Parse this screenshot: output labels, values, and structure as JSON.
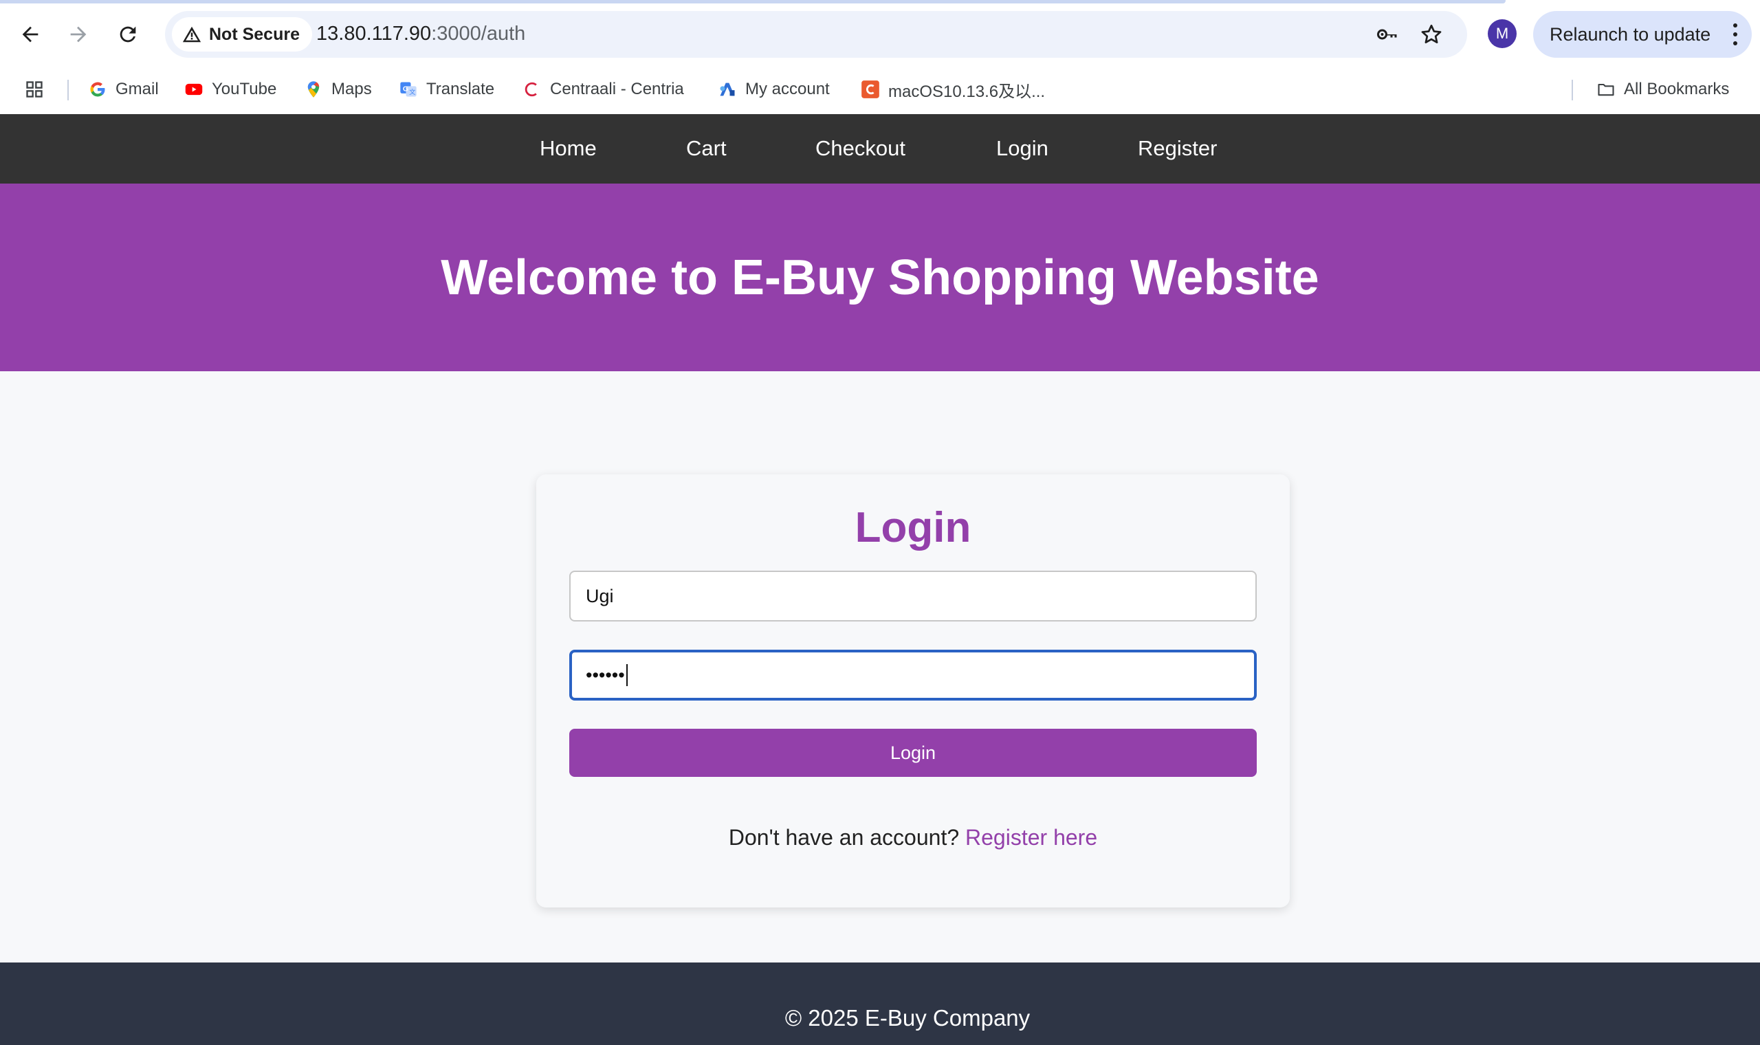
{
  "browser": {
    "security_label": "Not Secure",
    "url_host": "13.80.117.90",
    "url_path": ":3000/auth",
    "profile_initial": "M",
    "relaunch_label": "Relaunch to update",
    "bookmarks": [
      {
        "label": "Gmail",
        "icon": "gmail-icon"
      },
      {
        "label": "YouTube",
        "icon": "youtube-icon"
      },
      {
        "label": "Maps",
        "icon": "maps-icon"
      },
      {
        "label": "Translate",
        "icon": "translate-icon"
      },
      {
        "label": "Centraali - Centria",
        "icon": "centria-icon"
      },
      {
        "label": "My account",
        "icon": "azure-icon"
      },
      {
        "label": "macOS10.13.6及以...",
        "icon": "c-icon"
      }
    ],
    "all_bookmarks_label": "All Bookmarks"
  },
  "nav": {
    "items": [
      "Home",
      "Cart",
      "Checkout",
      "Login",
      "Register"
    ]
  },
  "hero": {
    "title": "Welcome to E-Buy Shopping Website"
  },
  "login": {
    "heading": "Login",
    "username_value": "Ugi",
    "password_mask": "••••••",
    "button_label": "Login",
    "register_prompt": "Don't have an account?",
    "register_link": "Register here"
  },
  "footer": {
    "text": "© 2025 E-Buy Company"
  },
  "colors": {
    "brand_purple": "#9340aa",
    "nav_dark": "#333333",
    "footer_dark": "#2e3545",
    "focus_blue": "#2a62c4"
  }
}
